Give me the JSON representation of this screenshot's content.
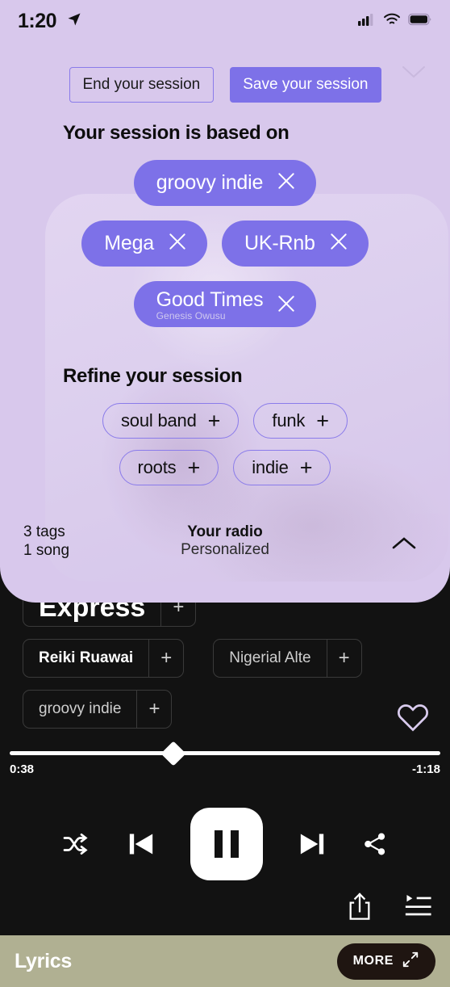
{
  "status_bar": {
    "time": "1:20",
    "location_icon": "location-arrow-icon",
    "signal_icon": "cellular-signal-icon",
    "wifi_icon": "wifi-icon",
    "battery_icon": "battery-full-icon"
  },
  "session_panel": {
    "end_session_label": "End your session",
    "save_session_label": "Save your session",
    "collapse_icon": "chevron-down-icon",
    "based_on_title": "Your session is based on",
    "seeds": [
      [
        {
          "label": "groovy indie",
          "sub": ""
        }
      ],
      [
        {
          "label": "Mega",
          "sub": ""
        },
        {
          "label": "UK-Rnb",
          "sub": ""
        }
      ],
      [
        {
          "label": "Good Times",
          "sub": "Genesis Owusu"
        }
      ]
    ],
    "refine_title": "Refine your session",
    "refine": [
      [
        {
          "label": "soul band"
        },
        {
          "label": "funk"
        }
      ],
      [
        {
          "label": "roots"
        },
        {
          "label": "indie"
        }
      ]
    ],
    "footer": {
      "tags_count": "3 tags",
      "songs_count": "1 song",
      "radio_title": "Your radio",
      "radio_subtitle": "Personalized",
      "expand_icon": "chevron-up-icon"
    }
  },
  "player": {
    "tag_chips": [
      [
        {
          "label": "Express",
          "style": "big",
          "plus": "+"
        }
      ],
      [
        {
          "label": "Reiki Ruawai",
          "style": "strong",
          "plus": "+"
        },
        {
          "label": "Nigerial Alte",
          "style": "normal",
          "plus": "+"
        }
      ],
      [
        {
          "label": "groovy indie",
          "style": "normal",
          "plus": "+"
        }
      ]
    ],
    "favorite_icon": "heart-outline-icon",
    "progress": {
      "elapsed": "0:38",
      "remaining": "-1:18",
      "percent": 38
    },
    "controls": {
      "shuffle_icon": "shuffle-icon",
      "previous_icon": "skip-previous-icon",
      "play_pause_icon": "pause-icon",
      "next_icon": "skip-next-icon",
      "share_icon": "share-nodes-icon"
    },
    "bottom_icons": {
      "export_icon": "share-upload-icon",
      "queue_icon": "queue-list-icon"
    }
  },
  "lyrics_bar": {
    "title": "Lyrics",
    "more_label": "MORE",
    "expand_icon": "expand-diagonal-icon"
  },
  "colors": {
    "panel_background": "#d8c8ec",
    "accent_purple": "#7d71e8",
    "outline_purple": "#8a7bea",
    "player_background": "#121212",
    "lyrics_background": "#b0b092",
    "more_button": "#1f1511"
  }
}
